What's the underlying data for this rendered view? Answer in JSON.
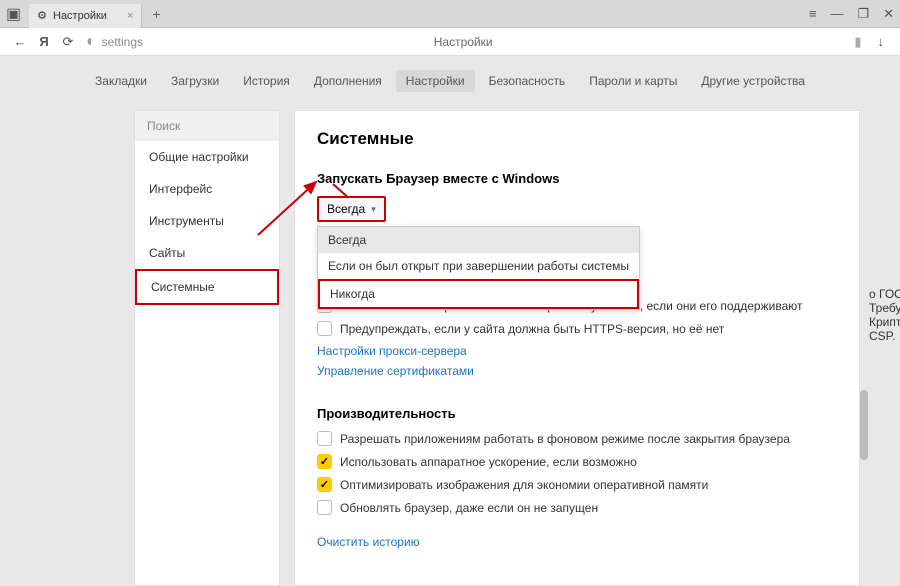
{
  "titlebar": {
    "tab_title": "Настройки",
    "close": "×",
    "newtab": "+",
    "menu": "≡",
    "minimize": "—",
    "maximize": "❐",
    "closewin": "✕"
  },
  "toolbar": {
    "back": "←",
    "ya": "Я",
    "reload": "⟳",
    "url": "settings",
    "page_title": "Настройки",
    "bookmark": "▮",
    "download": "↓"
  },
  "topnav": {
    "items": [
      {
        "label": "Закладки"
      },
      {
        "label": "Загрузки"
      },
      {
        "label": "История"
      },
      {
        "label": "Дополнения"
      },
      {
        "label": "Настройки",
        "active": true
      },
      {
        "label": "Безопасность"
      },
      {
        "label": "Пароли и карты"
      },
      {
        "label": "Другие устройства"
      }
    ]
  },
  "sidebar": {
    "search_placeholder": "Поиск",
    "items": [
      {
        "label": "Общие настройки"
      },
      {
        "label": "Интерфейс"
      },
      {
        "label": "Инструменты"
      },
      {
        "label": "Сайты"
      },
      {
        "label": "Системные",
        "selected": true
      }
    ]
  },
  "main": {
    "title": "Системные",
    "section1": {
      "heading": "Запускать Браузер вместе с Windows",
      "selected": "Всегда",
      "options": [
        "Всегда",
        "Если он был открыт при завершении работы системы",
        "Никогда"
      ]
    },
    "gost_tail": "о ГОСТ. Требуется КриптоПро CSP.",
    "https_auto": "Автоматически открывать сайты по протоколу HTTPS, если они его поддерживают",
    "https_warn": "Предупреждать, если у сайта должна быть HTTPS-версия, но её нет",
    "proxy_link": "Настройки прокси-сервера",
    "cert_link": "Управление сертификатами",
    "section2": {
      "heading": "Производительность",
      "bg_apps": "Разрешать приложениям работать в фоновом режиме после закрытия браузера",
      "hw_accel": "Использовать аппаратное ускорение, если возможно",
      "optimize_img": "Оптимизировать изображения для экономии оперативной памяти",
      "update_bg": "Обновлять браузер, даже если он не запущен"
    },
    "clear_history": "Очистить историю"
  }
}
